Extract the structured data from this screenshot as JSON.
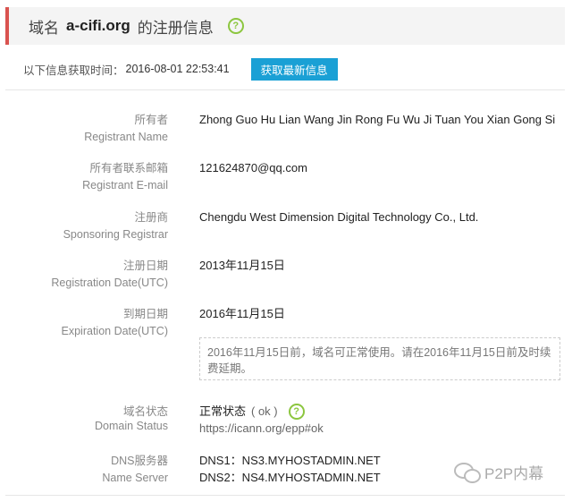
{
  "header": {
    "prefix": "域名",
    "domain": "a-cifi.org",
    "suffix": "的注册信息",
    "help_glyph": "?"
  },
  "fetch": {
    "label": "以下信息获取时间：",
    "time": "2016-08-01 22:53:41",
    "refresh_button": "获取最新信息"
  },
  "fields": {
    "registrant_name": {
      "label_cn": "所有者",
      "label_en": "Registrant Name",
      "value": "Zhong Guo Hu Lian Wang Jin Rong Fu Wu Ji Tuan You Xian Gong Si"
    },
    "registrant_email": {
      "label_cn": "所有者联系邮箱",
      "label_en": "Registrant E-mail",
      "value": "121624870@qq.com"
    },
    "registrar": {
      "label_cn": "注册商",
      "label_en": "Sponsoring Registrar",
      "value": "Chengdu West Dimension Digital Technology Co., Ltd."
    },
    "registration_date": {
      "label_cn": "注册日期",
      "label_en": "Registration Date(UTC)",
      "value": "2013年11月15日"
    },
    "expiration_date": {
      "label_cn": "到期日期",
      "label_en": "Expiration Date(UTC)",
      "value": "2016年11月15日",
      "notice": "2016年11月15日前，域名可正常使用。请在2016年11月15日前及时续费延期。"
    },
    "domain_status": {
      "label_cn": "域名状态",
      "label_en": "Domain Status",
      "value": "正常状态",
      "code": "( ok )",
      "link": "https://icann.org/epp#ok",
      "help_glyph": "?"
    },
    "name_server": {
      "label_cn": "DNS服务器",
      "label_en": "Name Server",
      "dns1": "DNS1：NS3.MYHOSTADMIN.NET",
      "dns2": "DNS2：NS4.MYHOSTADMIN.NET"
    }
  },
  "watermark": {
    "text": "P2P内幕",
    "icon": "wechat-icon"
  }
}
